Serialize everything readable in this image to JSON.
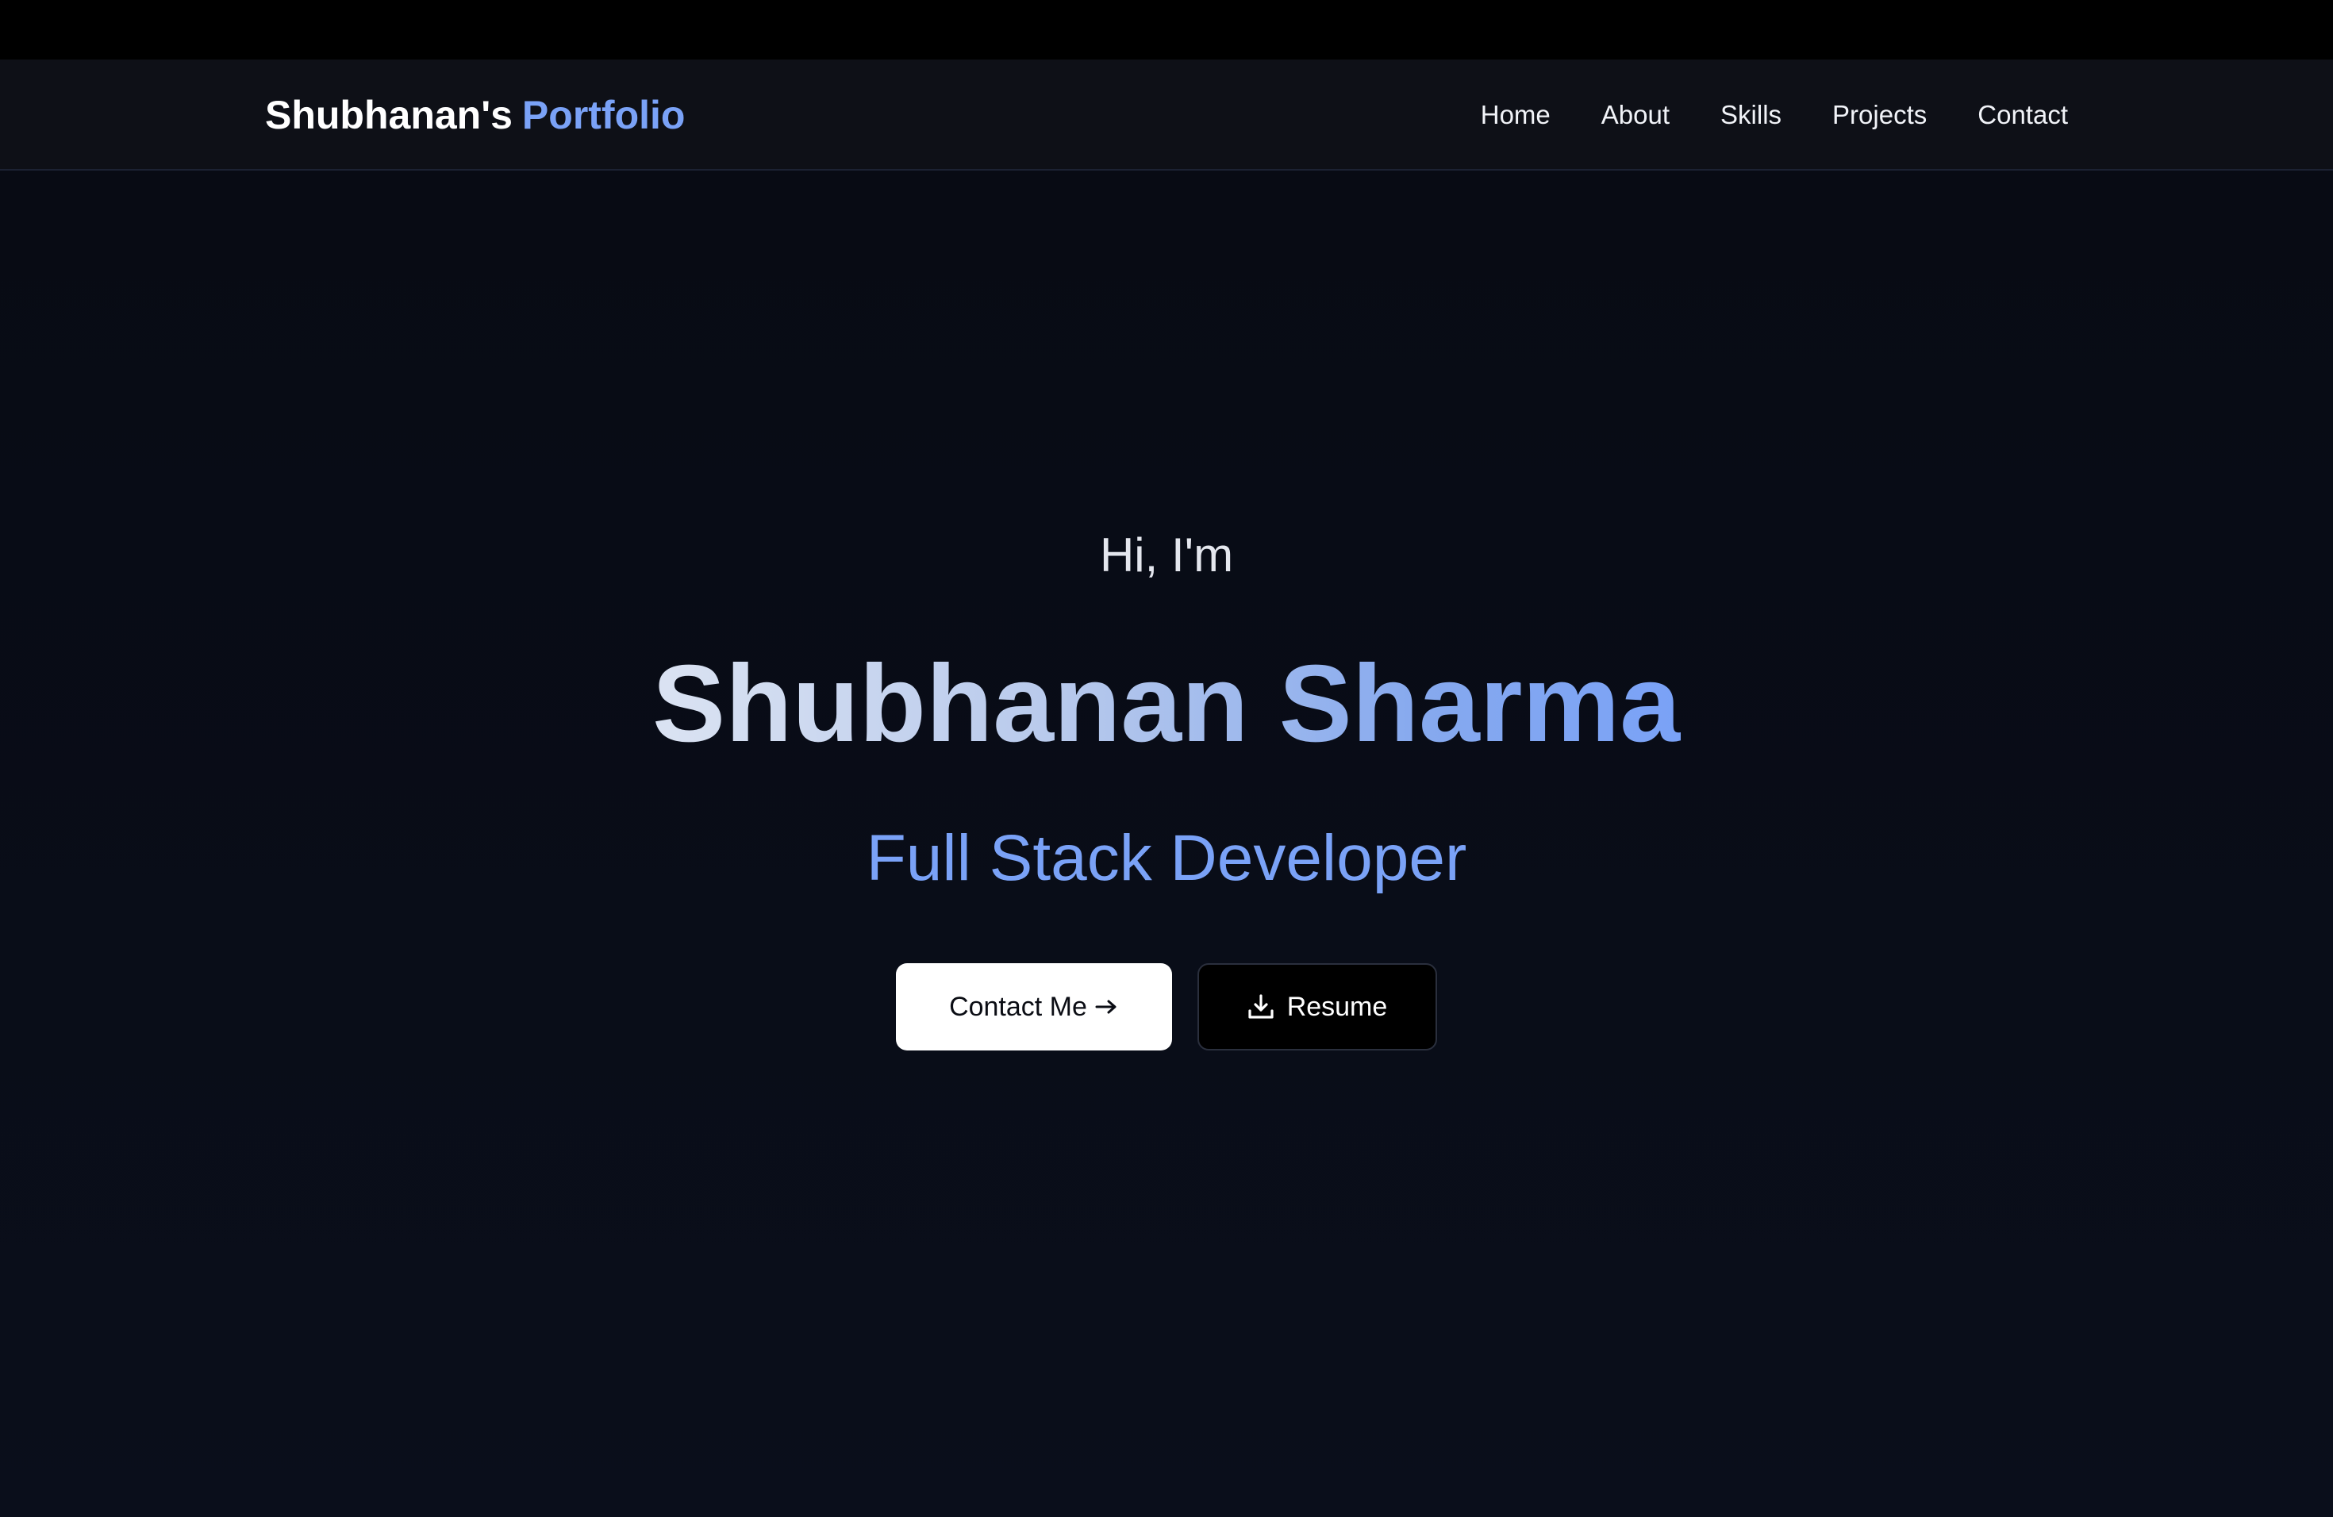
{
  "header": {
    "brand_name": "Shubhanan's",
    "brand_accent": "Portfolio",
    "nav": [
      {
        "label": "Home"
      },
      {
        "label": "About"
      },
      {
        "label": "Skills"
      },
      {
        "label": "Projects"
      },
      {
        "label": "Contact"
      }
    ]
  },
  "hero": {
    "greeting": "Hi, I'm",
    "name": "Shubhanan Sharma",
    "role": "Full Stack Developer",
    "contact_button": "Contact Me",
    "resume_button": "Resume"
  },
  "colors": {
    "accent": "#7aa2f7",
    "background": "#080b14",
    "navbar": "#0e1017"
  },
  "icons": {
    "contact_button_icon": "arrow-right-icon",
    "resume_button_icon": "download-icon"
  }
}
